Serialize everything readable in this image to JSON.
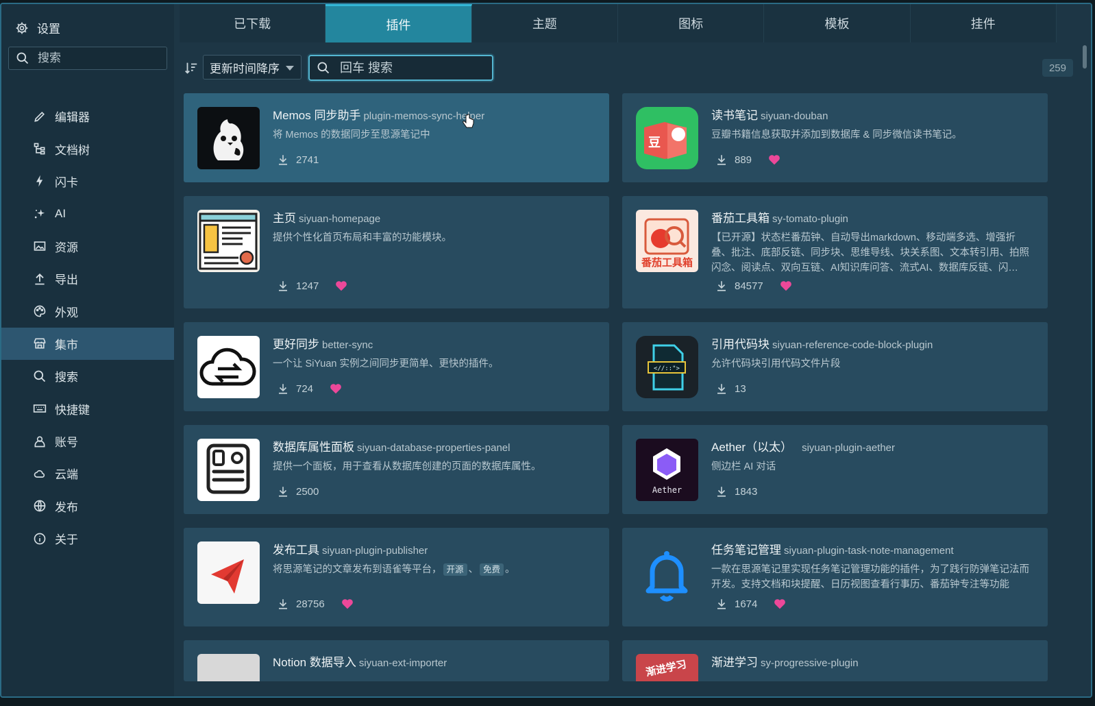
{
  "sidebar": {
    "title": "设置",
    "search_placeholder": "搜索",
    "items": [
      {
        "label": "编辑器",
        "icon": "pencil-icon"
      },
      {
        "label": "文档树",
        "icon": "tree-icon"
      },
      {
        "label": "闪卡",
        "icon": "lightning-icon"
      },
      {
        "label": "AI",
        "icon": "sparkle-icon"
      },
      {
        "label": "资源",
        "icon": "image-icon"
      },
      {
        "label": "导出",
        "icon": "upload-icon"
      },
      {
        "label": "外观",
        "icon": "palette-icon"
      },
      {
        "label": "集市",
        "icon": "store-icon",
        "active": true
      },
      {
        "label": "搜索",
        "icon": "search-icon"
      },
      {
        "label": "快捷键",
        "icon": "keyboard-icon"
      },
      {
        "label": "账号",
        "icon": "user-icon"
      },
      {
        "label": "云端",
        "icon": "cloud-icon"
      },
      {
        "label": "发布",
        "icon": "globe-icon"
      },
      {
        "label": "关于",
        "icon": "info-icon"
      }
    ]
  },
  "tabs": [
    {
      "label": "已下载"
    },
    {
      "label": "插件",
      "active": true
    },
    {
      "label": "主题"
    },
    {
      "label": "图标"
    },
    {
      "label": "模板"
    },
    {
      "label": "挂件"
    }
  ],
  "toolbar": {
    "sort_value": "更新时间降序",
    "search_placeholder": "回车 搜索",
    "count": "259"
  },
  "plugins": [
    {
      "name": "Memos 同步助手",
      "pkg": "plugin-memos-sync-helper",
      "desc": "将 Memos 的数据同步至思源笔记中",
      "downloads": "2741",
      "liked": false
    },
    {
      "name": "读书笔记",
      "pkg": "siyuan-douban",
      "desc": "豆瓣书籍信息获取并添加到数据库 & 同步微信读书笔记。",
      "downloads": "889",
      "liked": true
    },
    {
      "name": "主页",
      "pkg": "siyuan-homepage",
      "desc": "提供个性化首页布局和丰富的功能模块。",
      "downloads": "1247",
      "liked": true
    },
    {
      "name": "番茄工具箱",
      "pkg": "sy-tomato-plugin",
      "desc": "【已开源】状态栏番茄钟、自动导出markdown、移动端多选、增强折叠、批注、底部反链、同步块、思维导线、块关系图、文本转引用、拍照闪念、阅读点、双向互链、AI知识库问答、流式AI、数据库反链、闪…",
      "downloads": "84577",
      "liked": true
    },
    {
      "name": "更好同步",
      "pkg": "better-sync",
      "desc": "一个让 SiYuan 实例之间同步更简单、更快的插件。",
      "downloads": "724",
      "liked": true
    },
    {
      "name": "引用代码块",
      "pkg": "siyuan-reference-code-block-plugin",
      "desc": "允许代码块引用代码文件片段",
      "downloads": "13",
      "liked": false
    },
    {
      "name": "数据库属性面板",
      "pkg": "siyuan-database-properties-panel",
      "desc": "提供一个面板，用于查看从数据库创建的页面的数据库属性。",
      "downloads": "2500",
      "liked": false
    },
    {
      "name": "Aether（以太）",
      "pkg": "siyuan-plugin-aether",
      "desc": "侧边栏 AI 对话",
      "downloads": "1843",
      "liked": false
    },
    {
      "name": "发布工具",
      "pkg": "siyuan-plugin-publisher",
      "desc_pre": "将思源笔记的文章发布到语雀等平台，",
      "tag1": "开源",
      "sep": "、",
      "tag2": "免费",
      "desc_post": "。",
      "downloads": "28756",
      "liked": true
    },
    {
      "name": "任务笔记管理",
      "pkg": "siyuan-plugin-task-note-management",
      "desc": "一款在思源笔记里实现任务笔记管理功能的插件，为了践行防弹笔记法而开发。支持文档和块提醒、日历视图查看行事历、番茄钟专注等功能",
      "downloads": "1674",
      "liked": true
    },
    {
      "name": "Notion 数据导入",
      "pkg": "siyuan-ext-importer"
    },
    {
      "name": "渐进学习",
      "pkg": "sy-progressive-plugin"
    }
  ],
  "thumb_text": {
    "douban": "豆",
    "tomato": "番茄工具箱",
    "aether": "Aether",
    "progressive": "渐进学习"
  },
  "colors": {
    "accent": "#23869e",
    "heart": "#ec4899"
  }
}
